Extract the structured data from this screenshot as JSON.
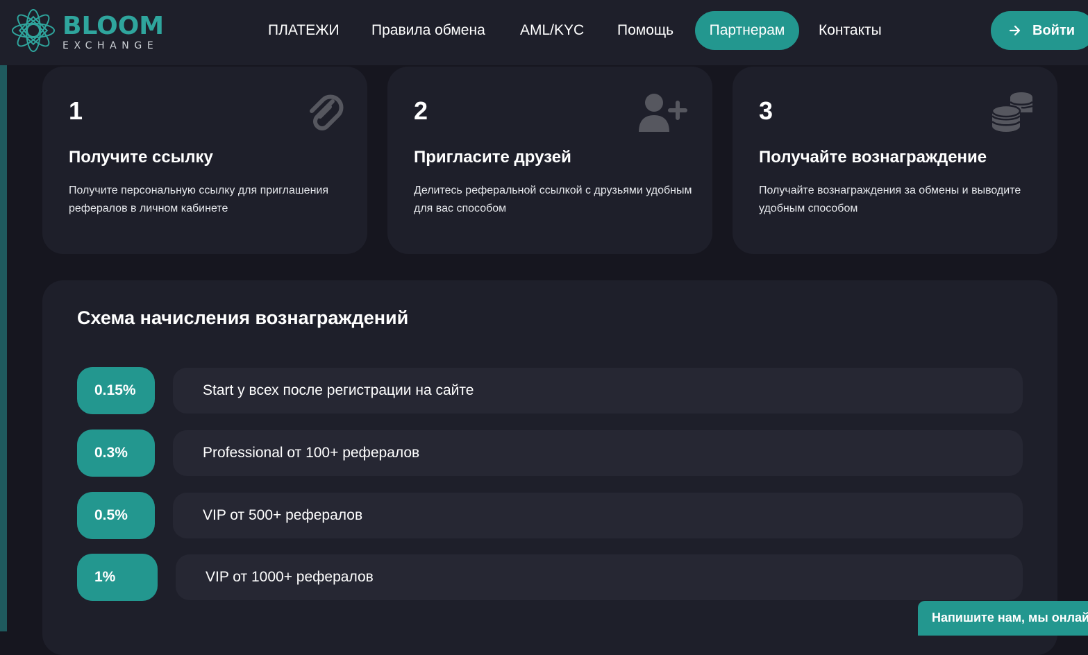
{
  "brand": {
    "name": "BLOOM",
    "subtitle": "EXCHANGE",
    "accent": "#23978f"
  },
  "nav": {
    "items": [
      {
        "label": "ПЛАТЕЖИ",
        "active": false
      },
      {
        "label": "Правила обмена",
        "active": false
      },
      {
        "label": "AML/KYC",
        "active": false
      },
      {
        "label": "Помощь",
        "active": false
      },
      {
        "label": "Партнерам",
        "active": true
      },
      {
        "label": "Контакты",
        "active": false
      }
    ],
    "login_label": "Войти",
    "login_icon": "login-arrow-icon"
  },
  "steps": [
    {
      "number": "1",
      "title": "Получите ссылку",
      "description": "Получите персональную ссылку для приглашения рефералов в личном кабинете",
      "icon": "paperclip-icon"
    },
    {
      "number": "2",
      "title": "Пригласите друзей",
      "description": "Делитесь реферальной ссылкой с друзьями удобным для вас способом",
      "icon": "user-plus-icon"
    },
    {
      "number": "3",
      "title": "Получайте вознаграждение",
      "description": "Получайте вознаграждения за обмены и выводите удобным способом",
      "icon": "coins-icon"
    }
  ],
  "scheme": {
    "title": "Схема начисления вознаграждений",
    "tiers": [
      {
        "rate": "0.15%",
        "description": "Start у всех после регистрации на сайте"
      },
      {
        "rate": "0.3%",
        "description": "Professional от 100+ рефералов"
      },
      {
        "rate": "0.5%",
        "description": "VIP от 500+ рефералов"
      },
      {
        "rate": "1%",
        "description": "VIP от 1000+ рефералов"
      }
    ]
  },
  "chat": {
    "label": "Напишите нам, мы онлайн"
  }
}
